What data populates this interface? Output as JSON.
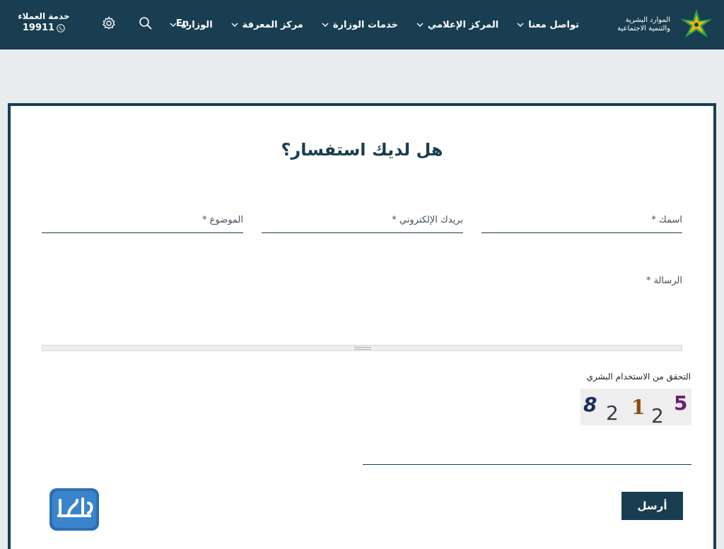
{
  "header": {
    "logo_line1": "الموارد البشرية",
    "logo_line2": "والتنمية الاجتماعية",
    "nav": [
      {
        "label": "الوزارة"
      },
      {
        "label": "مركز المعرفة"
      },
      {
        "label": "خدمات الوزارة"
      },
      {
        "label": "المركز الإعلامي"
      },
      {
        "label": "تواصل معنا"
      }
    ],
    "lang_label": "En",
    "customer_service_label": "خدمة العملاء",
    "customer_service_number": "19911",
    "colors": {
      "header_bg": "#1a3e51",
      "accent_green": "#2aa44f",
      "accent_yellow": "#f2b705"
    }
  },
  "form": {
    "title": "هل لديك استفسار؟",
    "name_label": "اسمك *",
    "email_label": "بريدك الإلكتروني *",
    "subject_label": "الموضوع *",
    "message_label": "الرسالة *",
    "captcha_label": "التحقق من الاستخدام البشري",
    "captcha_chars": [
      "8",
      "2",
      "1",
      "2",
      "5"
    ],
    "send_label": "أرسل"
  },
  "watermark_text": "المرجع"
}
